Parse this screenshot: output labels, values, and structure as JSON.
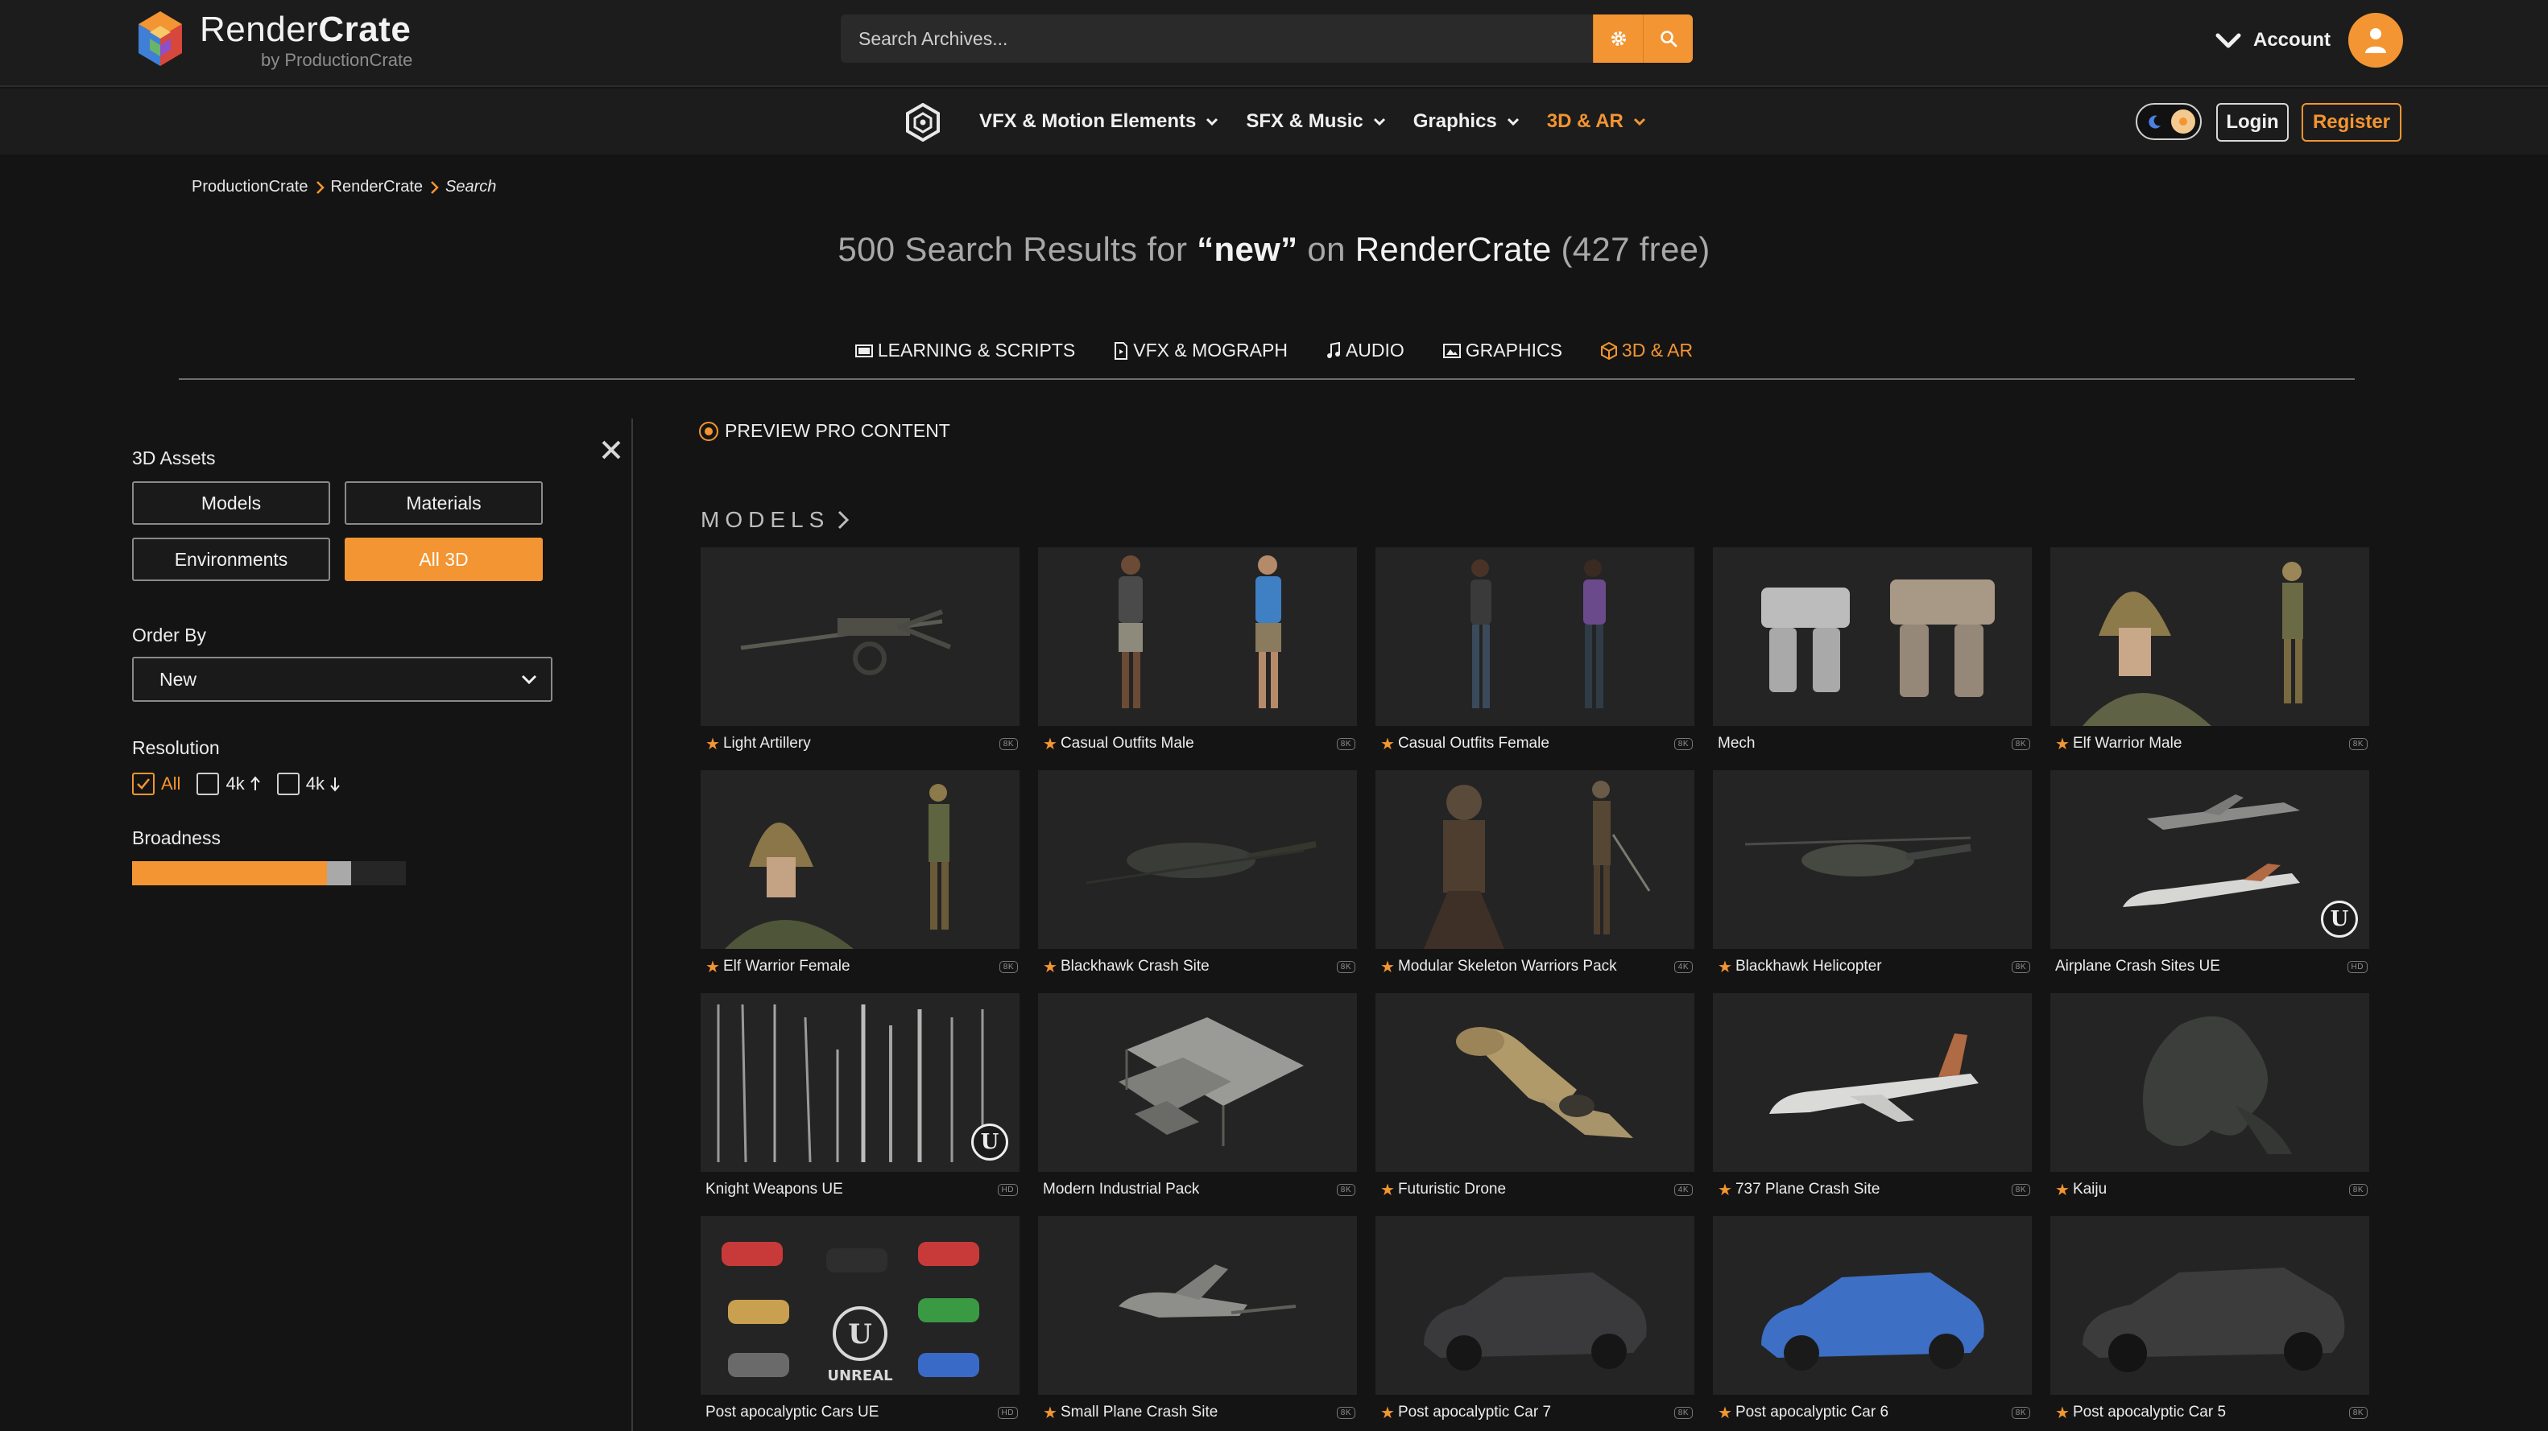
{
  "header": {
    "logo_title_light": "Render",
    "logo_title_bold": "Crate",
    "logo_sub": "by ProductionCrate",
    "search_placeholder": "Search Archives...",
    "account_label": "Account"
  },
  "nav": {
    "items": [
      {
        "label": "VFX & Motion Elements"
      },
      {
        "label": "SFX & Music"
      },
      {
        "label": "Graphics"
      },
      {
        "label": "3D & AR"
      }
    ],
    "active_index": 3,
    "login": "Login",
    "register": "Register"
  },
  "breadcrumb": {
    "items": [
      "ProductionCrate",
      "RenderCrate"
    ],
    "current": "Search"
  },
  "results": {
    "count_text": "500 Search Results for",
    "query": "“new”",
    "on_text": "on",
    "site": "RenderCrate",
    "free_text": "(427 free)"
  },
  "tabs": [
    {
      "label": "LEARNING & SCRIPTS",
      "icon": "film-icon"
    },
    {
      "label": "VFX & MOGRAPH",
      "icon": "file-video-icon"
    },
    {
      "label": "AUDIO",
      "icon": "music-note-icon"
    },
    {
      "label": "GRAPHICS",
      "icon": "image-icon"
    },
    {
      "label": "3D & AR",
      "icon": "cube-icon",
      "active": true
    }
  ],
  "sidebar": {
    "assets_label": "3D Assets",
    "asset_buttons": [
      "Models",
      "Materials",
      "Environments",
      "All 3D"
    ],
    "active_asset": "All 3D",
    "order_label": "Order By",
    "order_value": "New",
    "resolution_label": "Resolution",
    "resolution_options": [
      "All",
      "4k",
      "4k"
    ],
    "broadness_label": "Broadness",
    "broadness_value": 0.78
  },
  "main": {
    "preview_label": "PREVIEW PRO CONTENT",
    "section_title": "MODELS"
  },
  "colors": {
    "accent": "#f39532",
    "background": "#141414",
    "panel": "#1c1c1c"
  },
  "cards": [
    {
      "title": "Light Artillery",
      "pro": true,
      "res": "8K"
    },
    {
      "title": "Casual Outfits Male",
      "pro": true,
      "res": "8K"
    },
    {
      "title": "Casual Outfits Female",
      "pro": true,
      "res": "8K"
    },
    {
      "title": "Mech",
      "pro": false,
      "res": "8K"
    },
    {
      "title": "Elf Warrior Male",
      "pro": true,
      "res": "8K"
    },
    {
      "title": "Elf Warrior Female",
      "pro": true,
      "res": "8K"
    },
    {
      "title": "Blackhawk Crash Site",
      "pro": true,
      "res": "8K"
    },
    {
      "title": "Modular Skeleton Warriors Pack",
      "pro": true,
      "res": "4K"
    },
    {
      "title": "Blackhawk Helicopter",
      "pro": true,
      "res": "8K"
    },
    {
      "title": "Airplane Crash Sites UE",
      "pro": false,
      "res": "HD",
      "ue": true
    },
    {
      "title": "Knight Weapons UE",
      "pro": false,
      "res": "HD",
      "ue": true
    },
    {
      "title": "Modern Industrial Pack",
      "pro": false,
      "res": "8K"
    },
    {
      "title": "Futuristic Drone",
      "pro": true,
      "res": "4K"
    },
    {
      "title": "737 Plane Crash Site",
      "pro": true,
      "res": "8K"
    },
    {
      "title": "Kaiju",
      "pro": true,
      "res": "8K"
    },
    {
      "title": "Post apocalyptic Cars UE",
      "pro": false,
      "res": "HD",
      "ue": true
    },
    {
      "title": "Small Plane Crash Site",
      "pro": true,
      "res": "8K"
    },
    {
      "title": "Post apocalyptic Car 7",
      "pro": true,
      "res": "8K"
    },
    {
      "title": "Post apocalyptic Car 6",
      "pro": true,
      "res": "8K"
    },
    {
      "title": "Post apocalyptic Car 5",
      "pro": true,
      "res": "8K"
    }
  ]
}
